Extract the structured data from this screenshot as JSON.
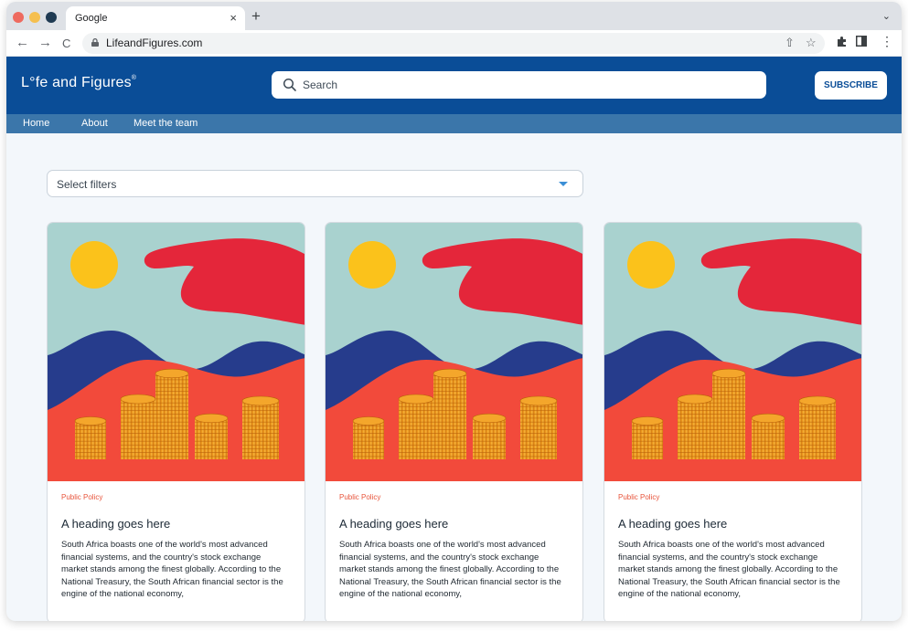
{
  "browser": {
    "tab_title": "Google",
    "tab_close": "×",
    "new_tab": "+",
    "tab_menu": "⌄",
    "url": "LifeandFigures.com",
    "nav": {
      "back": "←",
      "forward": "→",
      "reload": "C"
    },
    "omnibox_icons": {
      "share": "⇧",
      "bookmark": "☆"
    },
    "toolbar_icons": {
      "extensions": "puzzle-icon",
      "side_panel": "panel-icon",
      "menu": "⋮"
    }
  },
  "site": {
    "logo": "L°fe and Figures",
    "logo_mark": "®",
    "search_placeholder": "Search",
    "subscribe_label": "SUBSCRIBE",
    "nav_links": [
      "Home",
      "About",
      "Meet the team"
    ],
    "filter_label": "Select filters",
    "colors": {
      "header": "#0a4d97",
      "navbar": "#3b76aa",
      "accent": "#e8553c",
      "background": "#f3f7fb"
    }
  },
  "cards": [
    {
      "category": "Public Policy",
      "title": "A heading goes here",
      "body": "South Africa boasts one of the world's most advanced financial systems, and the country's stock exchange market stands among the finest globally. According to the National Treasury, the South African financial sector is the engine of the national economy,",
      "image": "illustration-hand-mountains-coins"
    },
    {
      "category": "Public Policy",
      "title": "A heading goes here",
      "body": "South Africa boasts one of the world's most advanced financial systems, and the country's stock exchange market stands among the finest globally. According to the National Treasury, the South African financial sector is the engine of the national economy,",
      "image": "illustration-hand-mountains-coins"
    },
    {
      "category": "Public Policy",
      "title": "A heading goes here",
      "body": "South Africa boasts one of the world's most advanced financial systems, and the country's stock exchange market stands among the finest globally. According to the National Treasury, the South African financial sector is the engine of the national economy,",
      "image": "illustration-hand-mountains-coins"
    }
  ]
}
